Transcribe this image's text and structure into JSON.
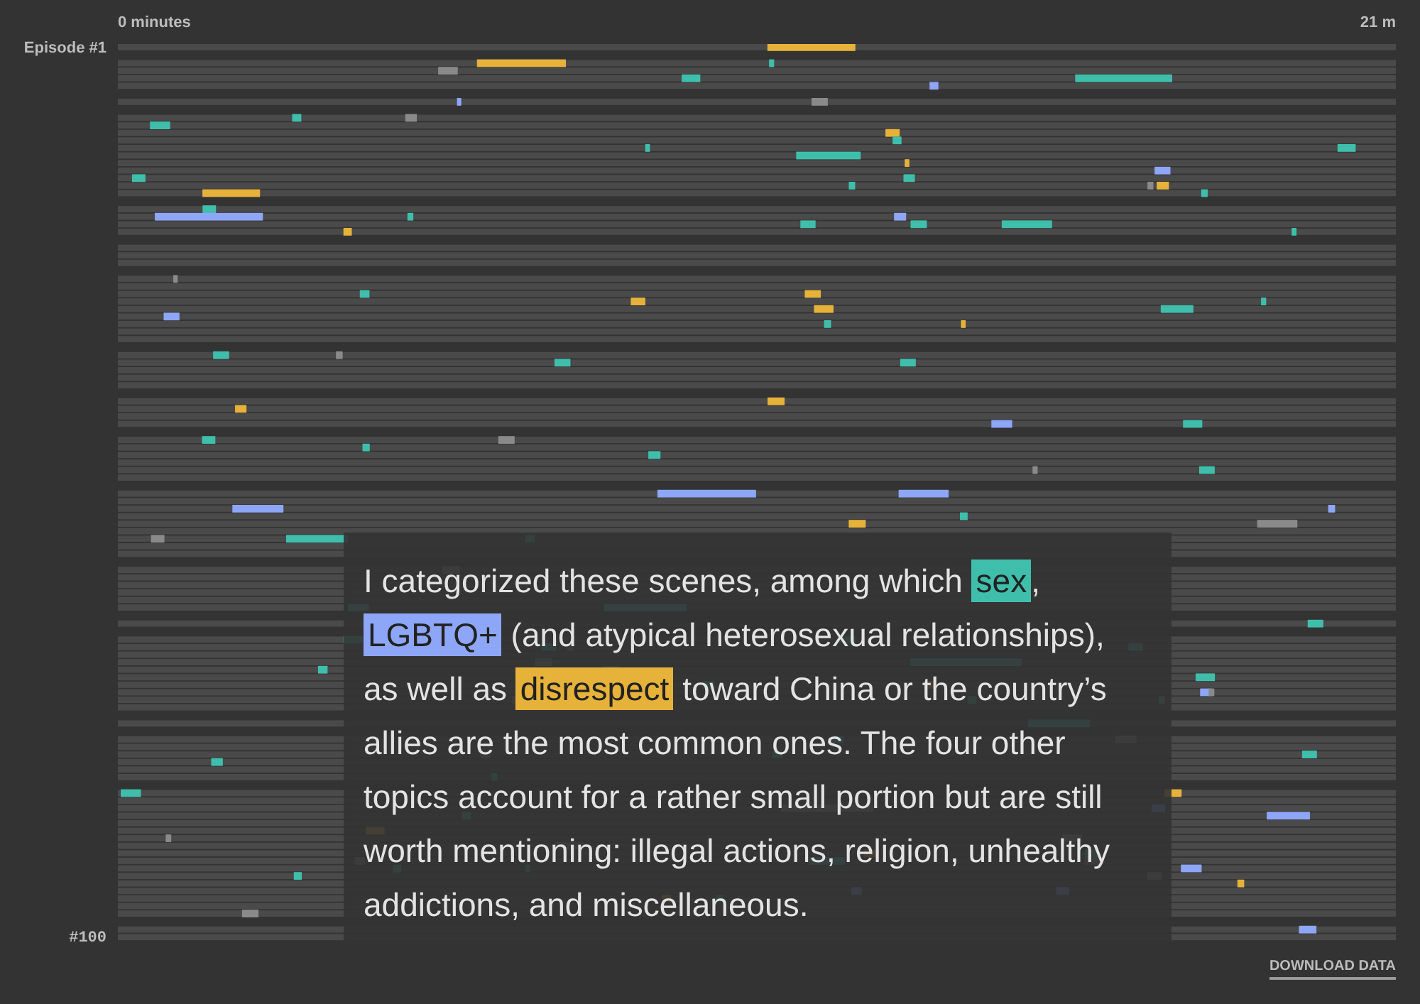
{
  "axis": {
    "start_label": "0 minutes",
    "end_label": "21 m"
  },
  "episodes": {
    "first_label": "Episode #1",
    "last_label": "#100"
  },
  "caption": {
    "segments": [
      {
        "kind": "text",
        "text": "I categorized these scenes, among which "
      },
      {
        "kind": "highlight",
        "text": "sex",
        "color": "#3fbfab"
      },
      {
        "kind": "text",
        "text": ", "
      },
      {
        "kind": "highlight",
        "text": "LGBTQ+",
        "color": "#8ea6f7"
      },
      {
        "kind": "text",
        "text": " (and atypical heterosexual relationships), as well as "
      },
      {
        "kind": "highlight",
        "text": "disrespect",
        "color": "#e6b23a"
      },
      {
        "kind": "text",
        "text": " toward China or the country’s allies are the most common ones. The four other topics account for a rather small portion but are still worth mentioning: illegal actions, religion, unhealthy addictions, and miscellaneous."
      }
    ]
  },
  "download_link": "DOWNLOAD DATA"
}
